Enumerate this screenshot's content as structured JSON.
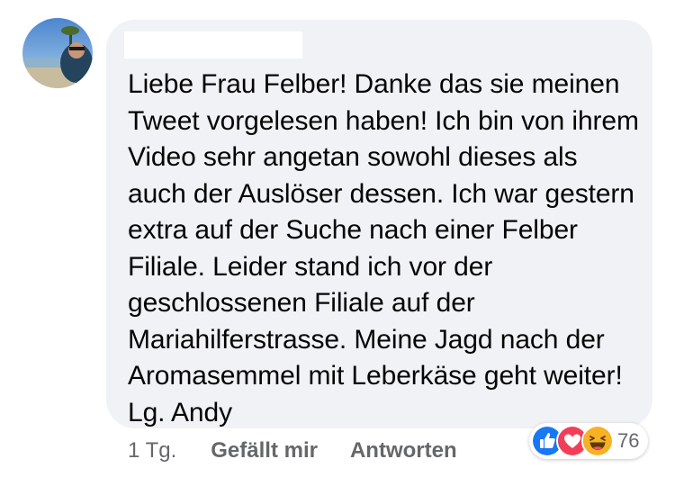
{
  "comment": {
    "text": "Liebe Frau Felber! Danke das sie meinen Tweet vorgelesen haben! Ich bin von ihrem Video sehr angetan sowohl dieses als auch der Auslöser dessen. Ich war gestern extra auf der Suche nach einer Felber Filiale. Leider stand ich vor der geschlossenen Filiale auf der Mariahilferstrasse. Meine Jagd nach der Aromasemmel mit Leberkäse geht weiter! Lg. Andy",
    "time": "1 Tg.",
    "like_label": "Gefällt mir",
    "reply_label": "Antworten"
  },
  "reactions": {
    "icons": [
      "like-icon",
      "love-icon",
      "haha-icon"
    ],
    "count": "76"
  },
  "colors": {
    "bubble": "#f0f2f5",
    "text": "#050505",
    "secondary_text": "#65676b",
    "like": "#1877f2",
    "love": "#f33e58",
    "haha": "#f7b125"
  }
}
